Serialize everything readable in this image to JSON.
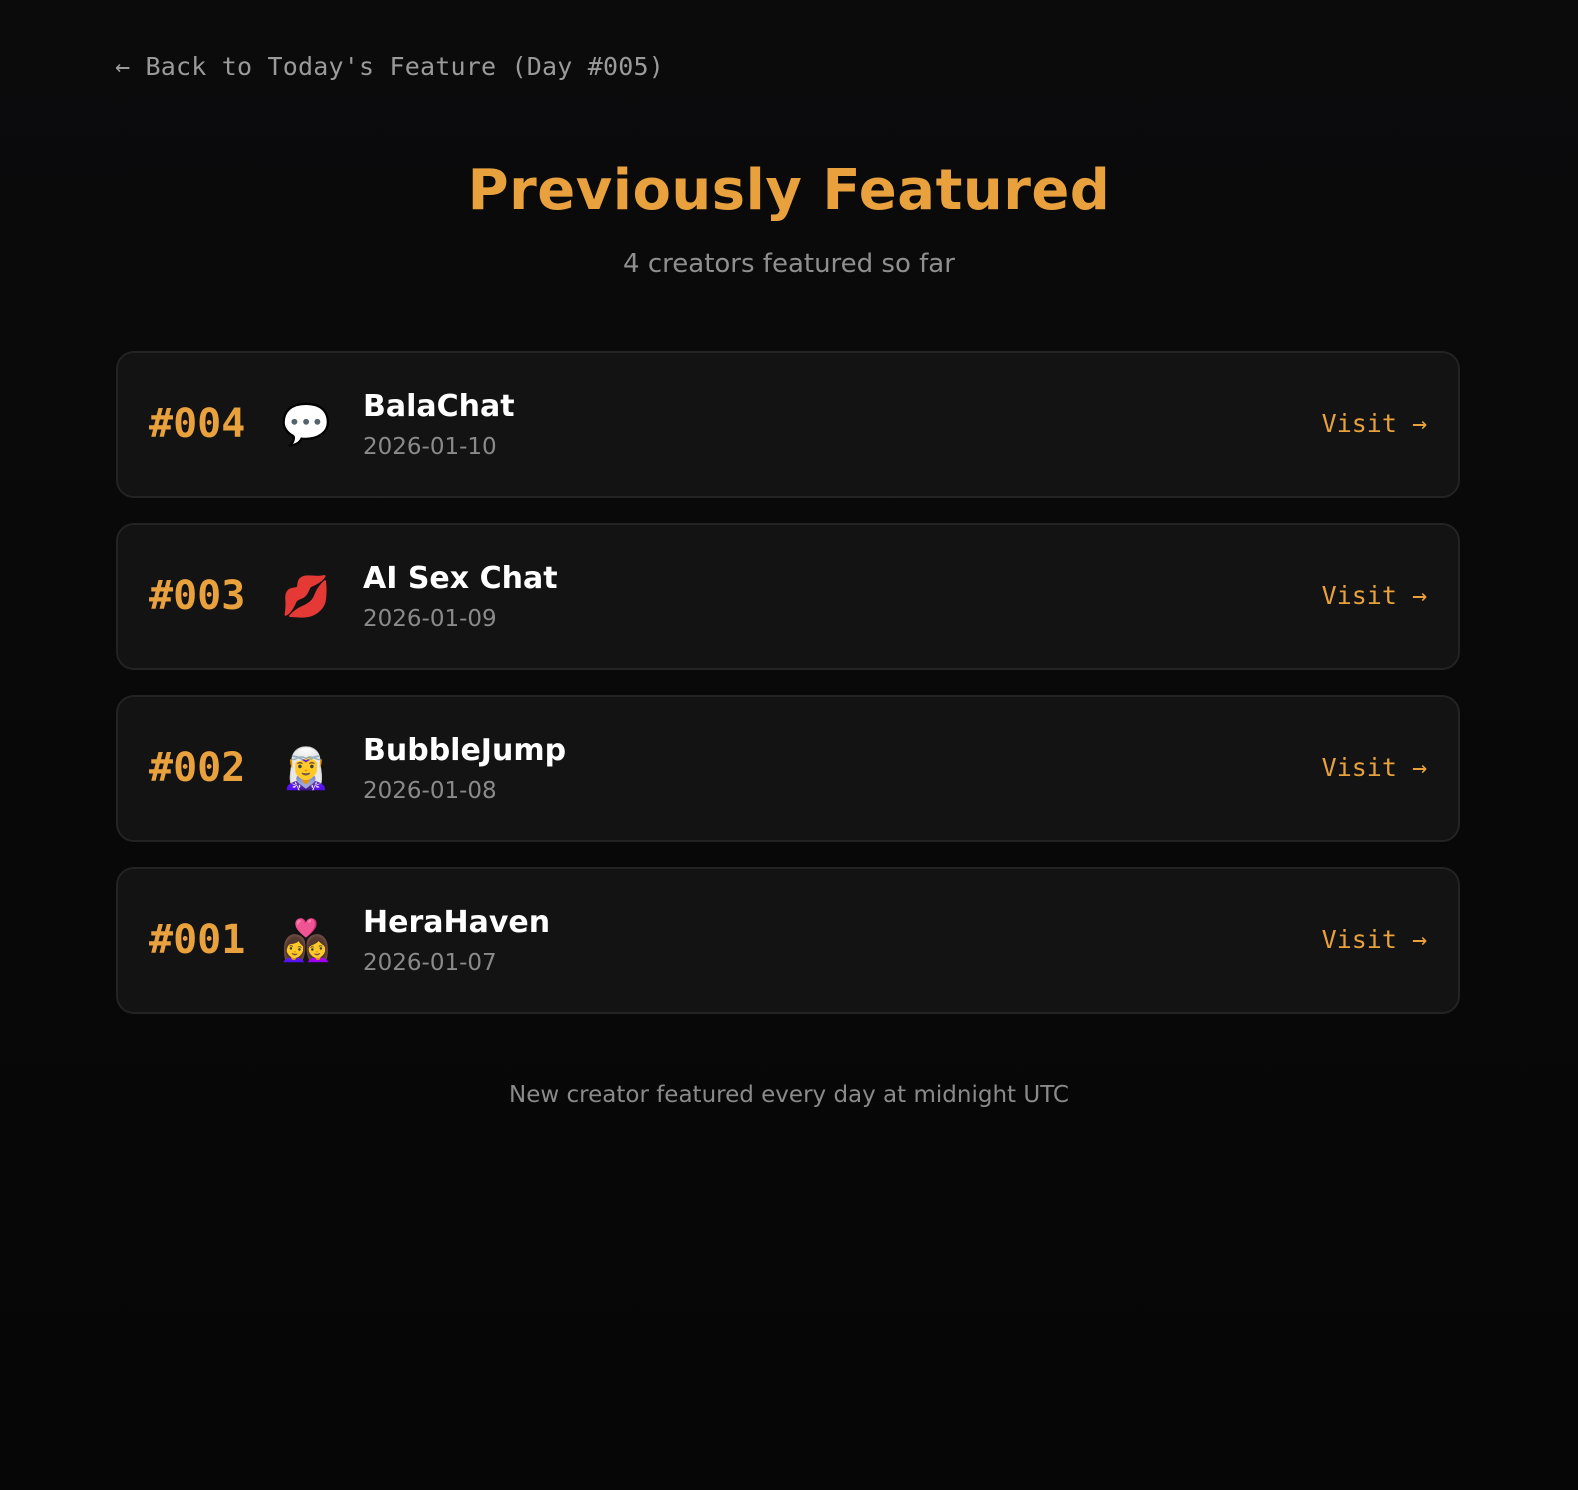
{
  "nav": {
    "back_label": "← Back to Today's Feature (Day #005)"
  },
  "header": {
    "title": "Previously Featured",
    "subtitle": "4 creators featured so far"
  },
  "creators": [
    {
      "number": "#004",
      "emoji": "💬",
      "icon_name": "speech-bubble-icon",
      "name": "BalaChat",
      "date": "2026-01-10",
      "visit_label": "Visit →"
    },
    {
      "number": "#003",
      "emoji": "💋",
      "icon_name": "kiss-mark-icon",
      "name": "AI Sex Chat",
      "date": "2026-01-09",
      "visit_label": "Visit →"
    },
    {
      "number": "#002",
      "emoji": "🧝‍♀️",
      "icon_name": "elf-icon",
      "name": "BubbleJump",
      "date": "2026-01-08",
      "visit_label": "Visit →"
    },
    {
      "number": "#001",
      "emoji": "👩‍❤️‍👩",
      "icon_name": "couple-with-heart-icon",
      "name": "HeraHaven",
      "date": "2026-01-07",
      "visit_label": "Visit →"
    }
  ],
  "footer": {
    "note": "New creator featured every day at midnight UTC"
  },
  "colors": {
    "accent": "#e8a13c",
    "background": "#0a0a0a",
    "card_background": "#131313",
    "card_border": "#232323",
    "muted_text": "#8a8a8a"
  }
}
